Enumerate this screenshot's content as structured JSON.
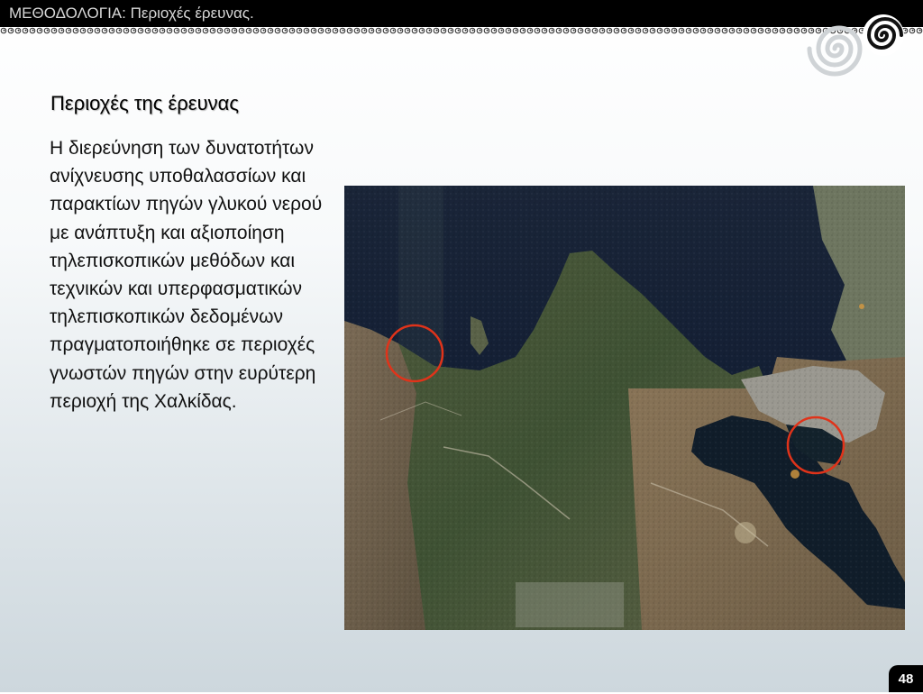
{
  "header": {
    "title": "ΜΕΘΟΔΟΛΟΓΙΑ: Περιοχές έρευνας."
  },
  "content": {
    "heading": "Περιοχές της έρευνας",
    "paragraph": "Η διερεύνηση των δυνατοτήτων ανίχνευσης υποθαλασσίων και παρακτίων πηγών γλυκού νερού με ανάπτυξη και αξιοποίηση τηλεπισκοπικών μεθόδων και τεχνικών και υπερφασματικών τηλεπισκοπικών δεδομένων πραγματοποιήθηκε σε περιοχές γνωστών πηγών στην ευρύτερη περιοχή της Χαλκίδας."
  },
  "map": {
    "marker_color": "#e0331a",
    "markers": [
      "spring-marker-west",
      "spring-marker-east"
    ]
  },
  "footer": {
    "page_number": "48"
  },
  "icons": [
    "spiral-logo-icon"
  ]
}
